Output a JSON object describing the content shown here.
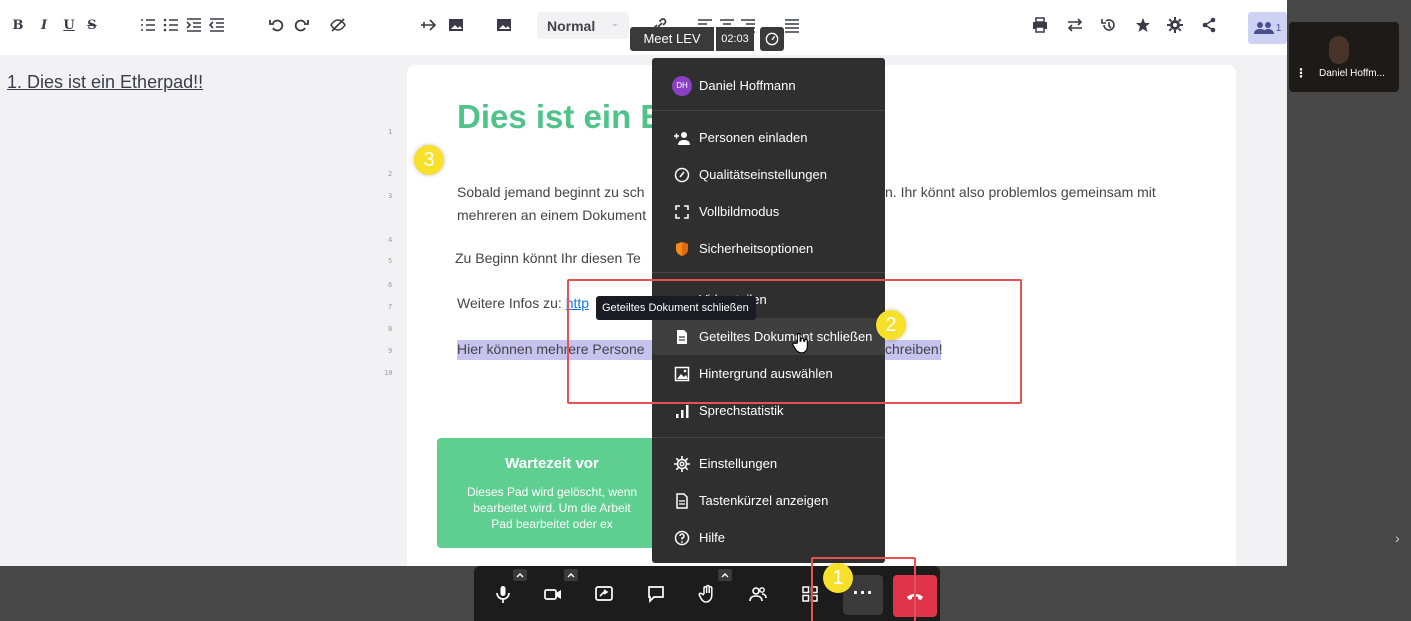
{
  "toolbar": {
    "bold": "B",
    "italic": "I",
    "underline": "U",
    "strike": "S",
    "paragraph_style": "Normal",
    "users_count": "1"
  },
  "left_panel": {
    "toc_item": "1. Dies ist ein Etherpad!!"
  },
  "document": {
    "line_numbers": [
      "1",
      "2",
      "3",
      "4",
      "5",
      "6",
      "7",
      "8",
      "9",
      "10"
    ],
    "title": "Dies ist ein E",
    "line3a": "Sobald jemand beginnt zu sch",
    "line3b": "n. Ihr könnt also problemlos gemeinsam mit",
    "line3c": "mehreren an einem Dokument",
    "line5": " Zu Beginn könnt Ihr diesen Te",
    "line7_prefix": "Weitere Infos zu: ",
    "line7_link": "http",
    "line9_left": "Hier können mehrere Persone",
    "line9_right": "chreiben!",
    "card": {
      "title": "Wartezeit vor",
      "line1": "Dieses Pad wird gelöscht, wenn",
      "line2": "bearbeitet wird. Um die Arbeit",
      "line3": "Pad bearbeitet oder ex"
    }
  },
  "meeting": {
    "name": "Meet LEV",
    "timer": "02:03"
  },
  "participant": {
    "name": "Daniel Hoffm..."
  },
  "menu": {
    "user": {
      "initials": "DH",
      "name": "Daniel Hoffmann"
    },
    "items": [
      {
        "label": "Personen einladen",
        "icon": "add-person-icon"
      },
      {
        "label": "Qualitätseinstellungen",
        "icon": "gauge-icon"
      },
      {
        "label": "Vollbildmodus",
        "icon": "fullscreen-icon"
      },
      {
        "label": "Sicherheitsoptionen",
        "icon": "shield-icon"
      },
      {
        "label": "Video teilen",
        "icon": "video-share-icon"
      },
      {
        "label": "Geteiltes Dokument schließen",
        "icon": "document-icon"
      },
      {
        "label": "Hintergrund auswählen",
        "icon": "image-icon"
      },
      {
        "label": "Sprechstatistik",
        "icon": "bar-chart-icon"
      },
      {
        "label": "Einstellungen",
        "icon": "gear-icon"
      },
      {
        "label": "Tastenkürzel anzeigen",
        "icon": "keyboard-icon"
      },
      {
        "label": "Hilfe",
        "icon": "help-icon"
      }
    ]
  },
  "tooltip": "Geteiltes Dokument schließen",
  "annotations": {
    "badge1": "1",
    "badge2": "2",
    "badge3": "3"
  },
  "colors": {
    "hangup": "#e0344b",
    "title_green": "#4fc38a",
    "highlight": "#c7c3ef",
    "annotation_red": "#e45252",
    "badge_yellow": "#f6e02a"
  }
}
